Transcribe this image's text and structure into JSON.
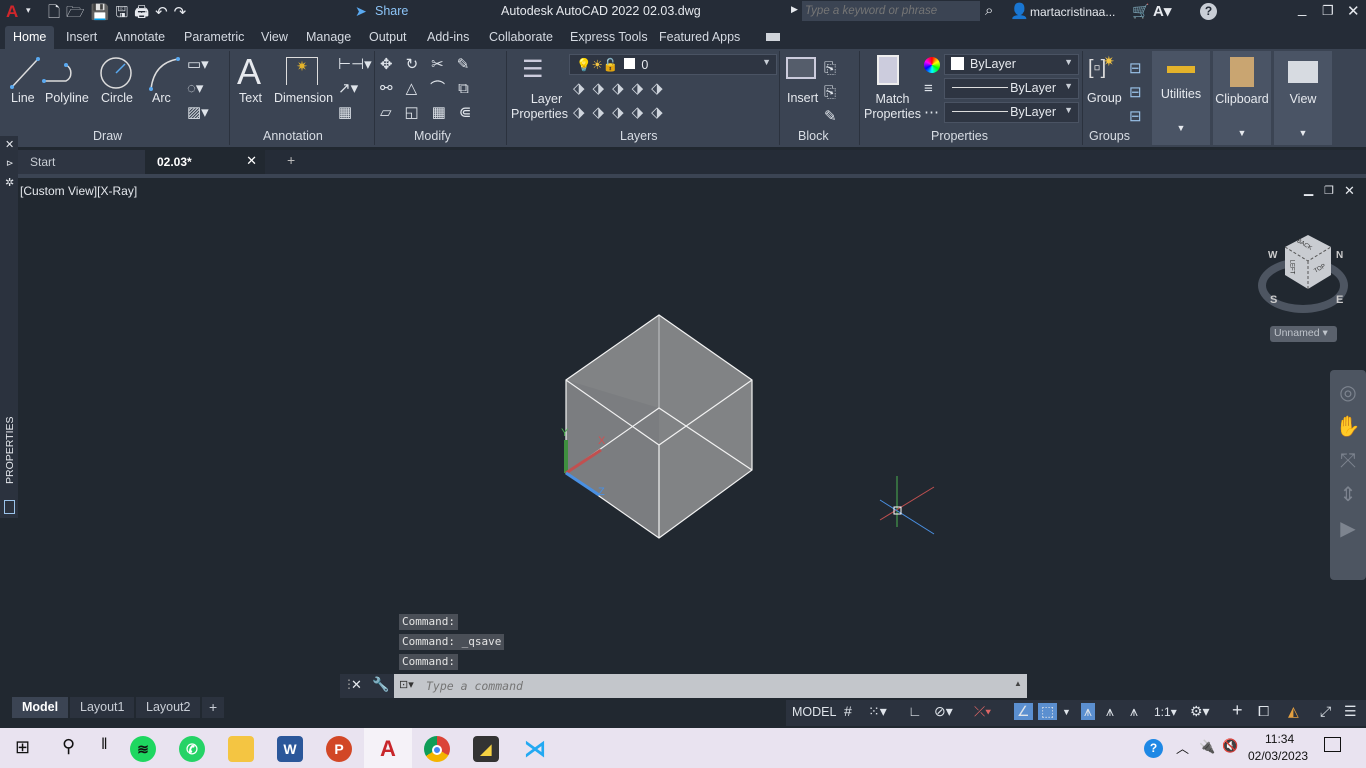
{
  "app": {
    "title": "Autodesk AutoCAD 2022",
    "filename": "02.03.dwg",
    "logo": "A",
    "share": "Share",
    "search_placeholder": "Type a keyword or phrase",
    "user": "martacristinaa..."
  },
  "ribbon_tabs": [
    "Home",
    "Insert",
    "Annotate",
    "Parametric",
    "View",
    "Manage",
    "Output",
    "Add-ins",
    "Collaborate",
    "Express Tools",
    "Featured Apps"
  ],
  "panels": {
    "draw": {
      "label": "Draw",
      "tools": [
        "Line",
        "Polyline",
        "Circle",
        "Arc"
      ]
    },
    "annotation": {
      "label": "Annotation",
      "tools": [
        "Text",
        "Dimension"
      ]
    },
    "modify": {
      "label": "Modify"
    },
    "layers": {
      "label": "Layers",
      "tool_line1": "Layer",
      "tool_line2": "Properties",
      "current_layer": "0"
    },
    "block": {
      "label": "Block",
      "tool": "Insert"
    },
    "properties": {
      "label": "Properties",
      "tool_line1": "Match",
      "tool_line2": "Properties",
      "color": "ByLayer",
      "lineweight": "ByLayer",
      "linetype": "ByLayer"
    },
    "groups": {
      "label": "Groups",
      "tool": "Group"
    },
    "flyouts": [
      "Utilities",
      "Clipboard",
      "View"
    ]
  },
  "file_tabs": [
    {
      "label": "Start"
    },
    {
      "label": "02.03*",
      "active": true
    }
  ],
  "viewport": {
    "label": "[Custom View][X-Ray]",
    "named_view": "Unnamed",
    "viewcube": {
      "faces": [
        "BACK",
        "LEFT",
        "TOP"
      ],
      "compass": [
        "W",
        "N",
        "S",
        "E"
      ]
    },
    "ucs": [
      "X",
      "Y",
      "Z"
    ]
  },
  "command": {
    "history": [
      "Command:",
      "Command: _qsave",
      "Command:"
    ],
    "placeholder": "Type a command"
  },
  "layout_tabs": [
    "Model",
    "Layout1",
    "Layout2"
  ],
  "status": {
    "model": "MODEL",
    "scale": "1:1"
  },
  "side_palette": "PROPERTIES",
  "clock": {
    "time": "11:34",
    "date": "02/03/2023"
  },
  "taskbar_apps": [
    "spotify",
    "whatsapp",
    "file-explorer",
    "word",
    "powerpoint",
    "autocad",
    "chrome",
    "sticky-notes",
    "vscode"
  ],
  "colors": {
    "ribbon": "#3b4453",
    "viewport": "#212830",
    "accent": "#5b8fd0",
    "taskbar": "#e9e3f0"
  }
}
